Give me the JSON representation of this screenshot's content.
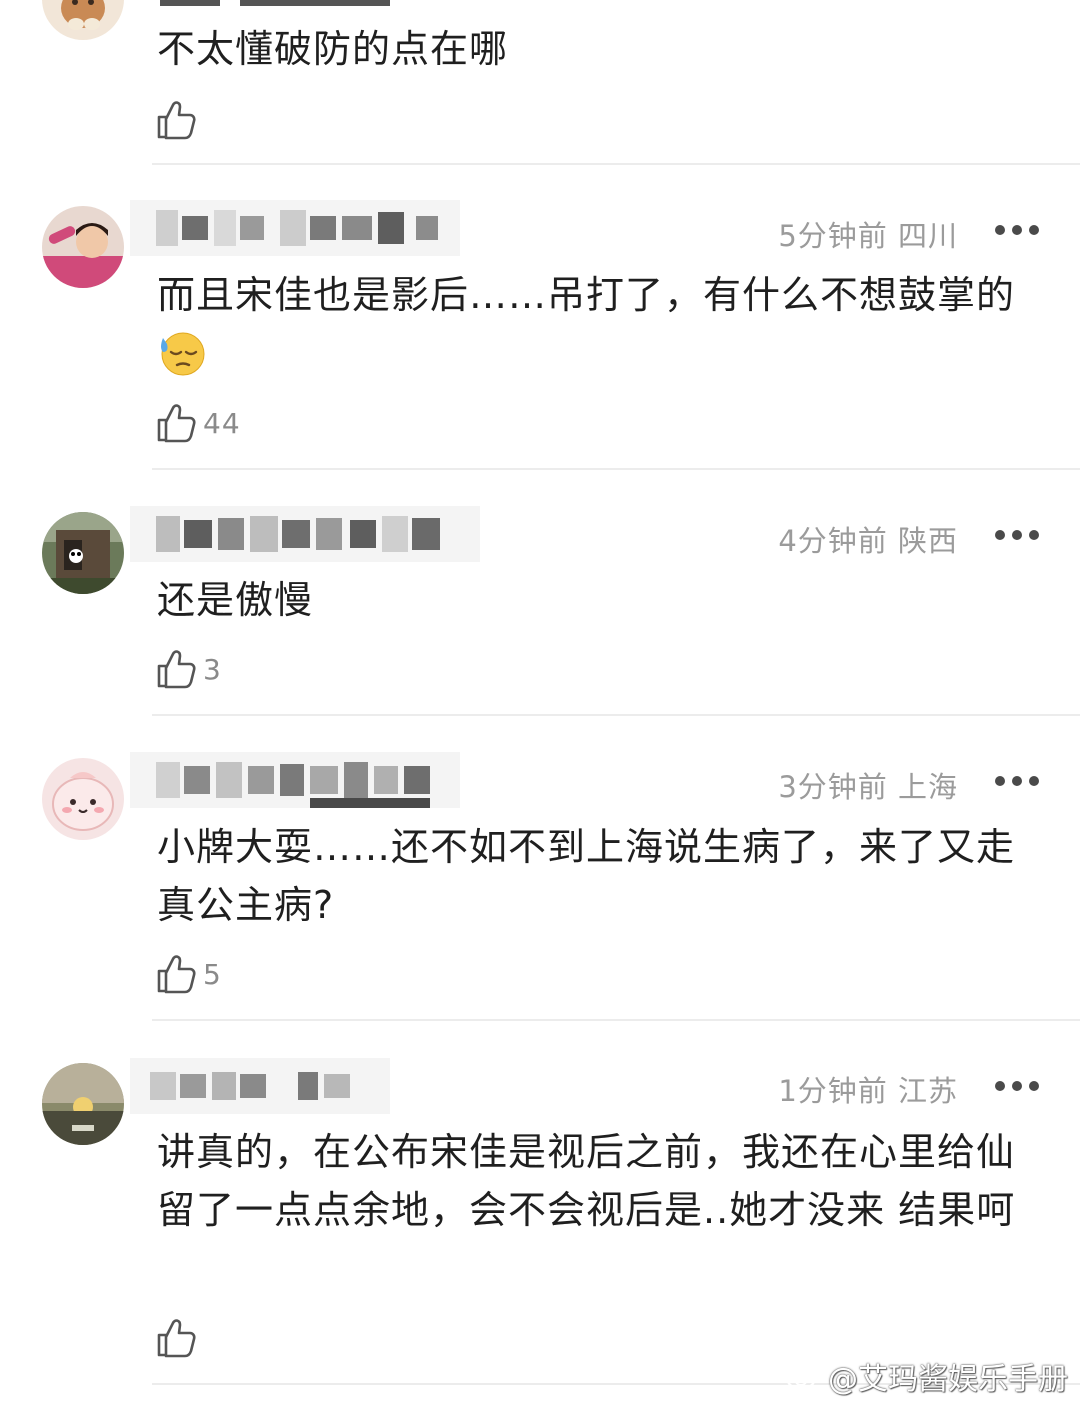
{
  "comments": [
    {
      "text": "不太懂破防的点在哪",
      "likes": "",
      "time": "",
      "location": ""
    },
    {
      "text": "而且宋佳也是影后……吊打了，有什么不想鼓掌的",
      "likes": "44",
      "time": "5分钟前",
      "location": "四川",
      "emoji": "downcast-sweat-emoji"
    },
    {
      "text": "还是傲慢",
      "likes": "3",
      "time": "4分钟前",
      "location": "陕西"
    },
    {
      "text": "小牌大耍……还不如不到上海说生病了，来了又走真公主病?",
      "likes": "5",
      "time": "3分钟前",
      "location": "上海"
    },
    {
      "text": "讲真的，在公布宋佳是视后之前，我还在心里给仙留了一点点余地，会不会视后是..她才没来 结果呵",
      "likes": "",
      "time": "1分钟前",
      "location": "江苏"
    }
  ],
  "watermark": {
    "text": "@艾玛酱娱乐手册",
    "icon": "weibo-logo-icon"
  },
  "colors": {
    "text": "#1f1f1f",
    "meta": "#9b9b9b",
    "divider": "#ececec",
    "icon": "#555555"
  }
}
